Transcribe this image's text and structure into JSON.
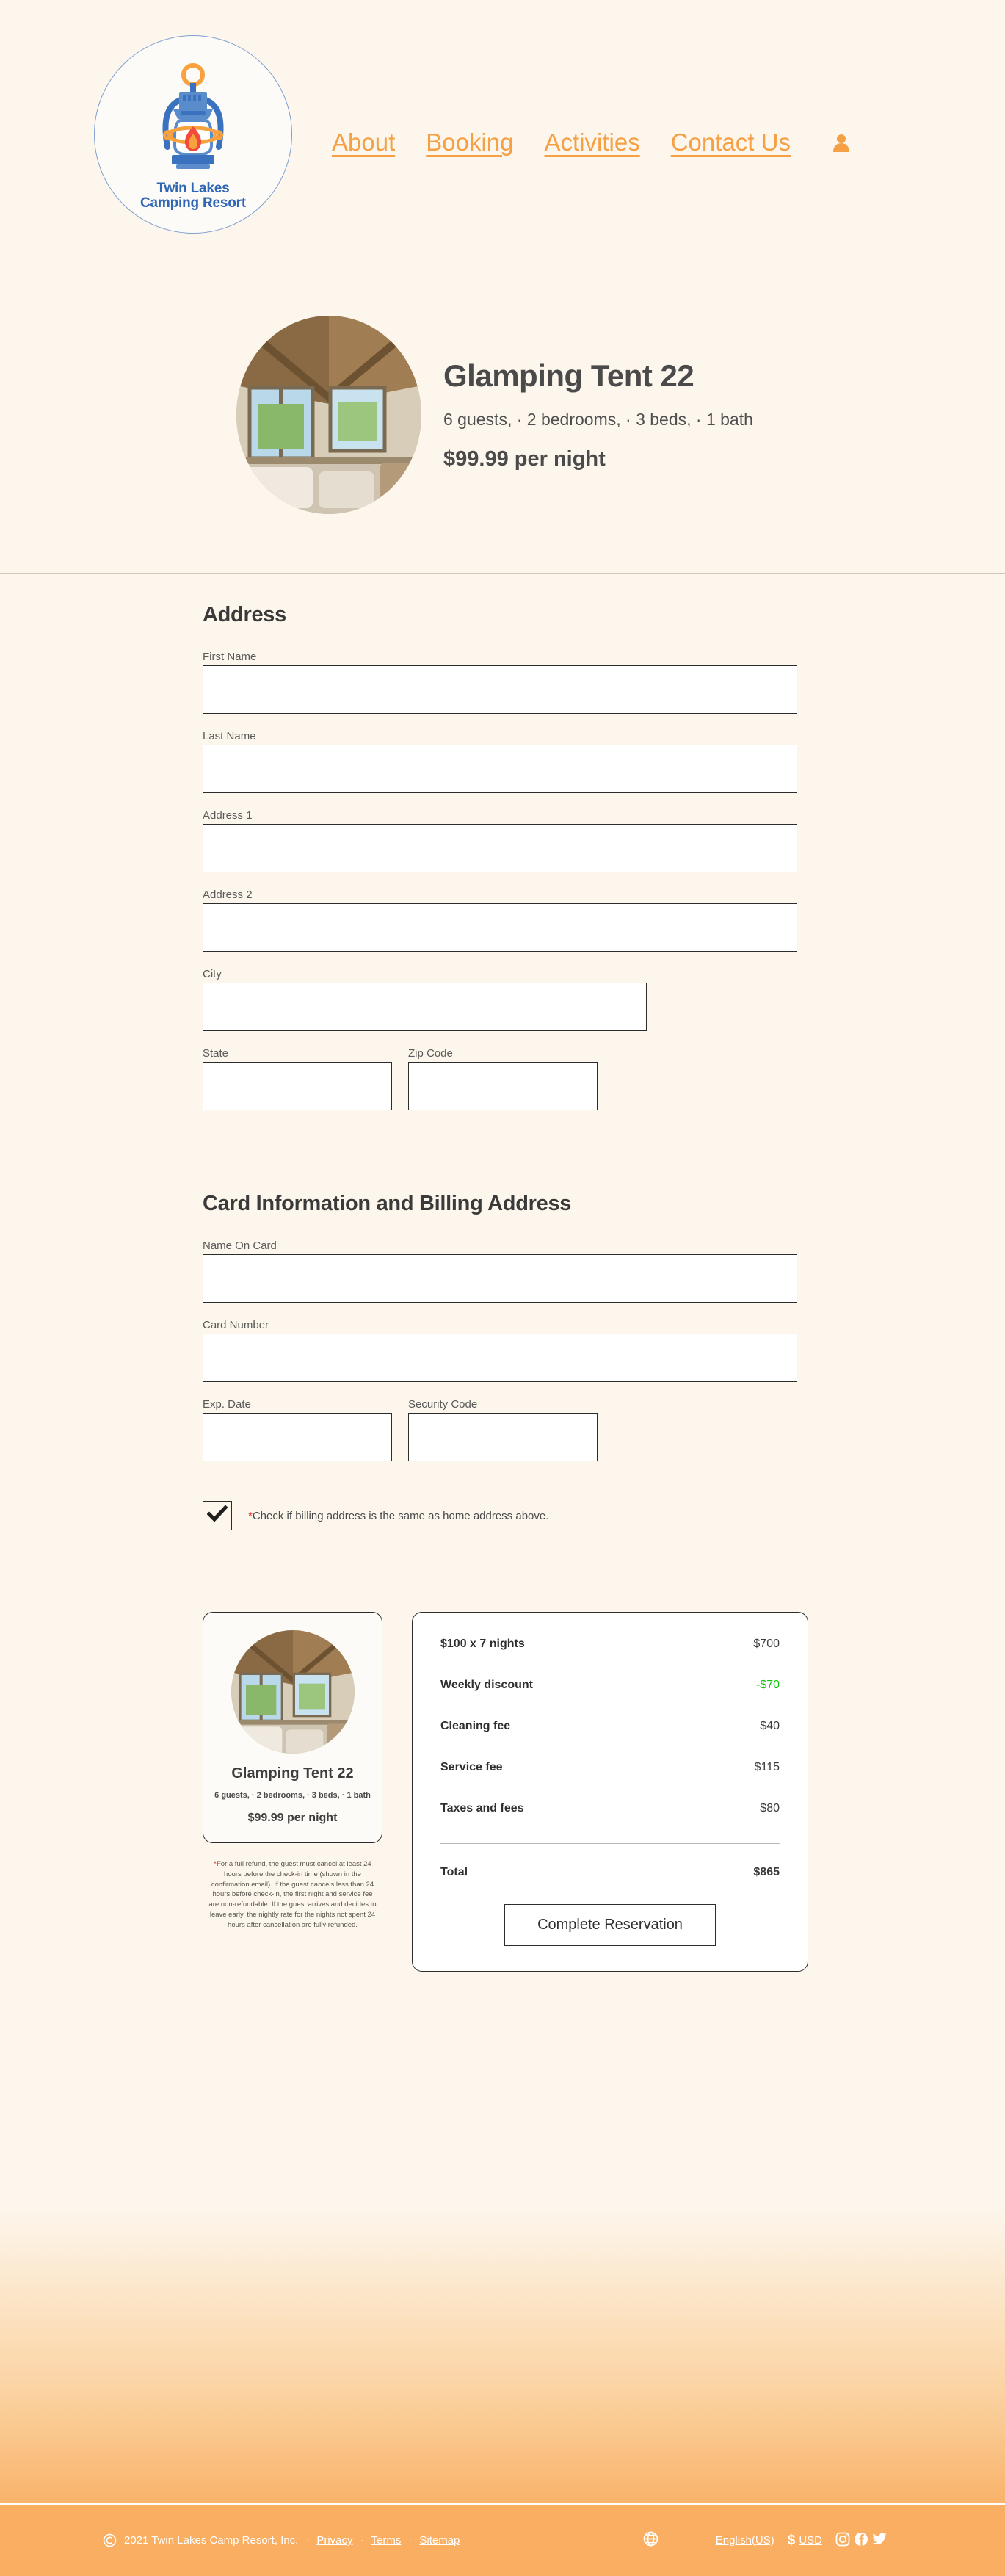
{
  "brand": {
    "logo_line1": "Twin Lakes",
    "logo_line2": "Camping Resort",
    "logo_icon": "lantern-icon",
    "blue": "#2f66b5",
    "orange": "#f5a045"
  },
  "nav": {
    "items": [
      {
        "label": "About"
      },
      {
        "label": "Booking"
      },
      {
        "label": "Activities"
      },
      {
        "label": "Contact Us"
      }
    ],
    "account_icon": "person-icon"
  },
  "property": {
    "name": "Glamping Tent 22",
    "details": "6 guests, · 2 bedrooms, · 3 beds, · 1 bath",
    "price": "$99.99 per night",
    "photo_alt": "glamping-tent-interior"
  },
  "address_section": {
    "title": "Address",
    "fields": [
      {
        "label": "First Name",
        "value": "",
        "placeholder": "",
        "size": "full"
      },
      {
        "label": "Last Name",
        "value": "",
        "placeholder": "",
        "size": "full"
      },
      {
        "label": "Address 1",
        "value": "",
        "placeholder": "",
        "size": "full"
      },
      {
        "label": "Address 2",
        "value": "",
        "placeholder": "",
        "size": "full"
      },
      {
        "label": "City",
        "value": "",
        "placeholder": "",
        "size": "medium"
      }
    ],
    "row_fields": [
      {
        "label": "State",
        "value": "",
        "placeholder": ""
      },
      {
        "label": "Zip Code",
        "value": "",
        "placeholder": ""
      }
    ]
  },
  "card_section": {
    "title": "Card Information and Billing Address",
    "fields": [
      {
        "label": "Name On Card",
        "value": "",
        "placeholder": ""
      },
      {
        "label": "Card Number",
        "value": "",
        "placeholder": ""
      }
    ],
    "row_fields": [
      {
        "label": "Exp. Date",
        "value": "",
        "placeholder": ""
      },
      {
        "label": "Security Code",
        "value": "",
        "placeholder": ""
      }
    ],
    "checkbox": {
      "checked": true,
      "asterisk": "*",
      "note": "Check if billing address is the same as home address above."
    }
  },
  "summary": {
    "title": "Glamping Tent 22",
    "details": "6 guests, · 2 bedrooms, · 3 beds, · 1 bath",
    "price": "$99.99 per night",
    "policy_asterisk": "*",
    "policy": "For a full refund, the guest must cancel at least 24 hours before the check-in time (shown in the confirmation email). If the guest cancels less than 24 hours before check-in, the first night and service fee are non-refundable. If the guest arrives and decides to leave early, the nightly rate for the nights not spent 24 hours after cancellation are fully refunded."
  },
  "price_breakdown": {
    "rows": [
      {
        "label": "$100 x 7 nights",
        "value": "$700",
        "discount": false
      },
      {
        "label": "Weekly discount",
        "value": "-$70",
        "discount": true
      },
      {
        "label": "Cleaning fee",
        "value": "$40",
        "discount": false
      },
      {
        "label": "Service fee",
        "value": "$115",
        "discount": false
      },
      {
        "label": "Taxes and fees",
        "value": "$80",
        "discount": false
      }
    ],
    "total_label": "Total",
    "total_value": "$865",
    "cta": "Complete Reservation",
    "discount_color": "#0ac20a"
  },
  "footer": {
    "copyright_icon": "copyright-icon",
    "copyright": "2021 Twin Lakes Camp Resort, Inc.",
    "links": [
      {
        "label": "Privacy"
      },
      {
        "label": "Terms"
      },
      {
        "label": "Sitemap"
      }
    ],
    "separator": "·",
    "globe_icon": "globe-icon",
    "language": "English(US)",
    "currency_symbol": "$",
    "currency": "USD",
    "socials": [
      {
        "name": "instagram-icon"
      },
      {
        "name": "facebook-icon"
      },
      {
        "name": "twitter-icon"
      }
    ],
    "background": "#f9ae61"
  }
}
